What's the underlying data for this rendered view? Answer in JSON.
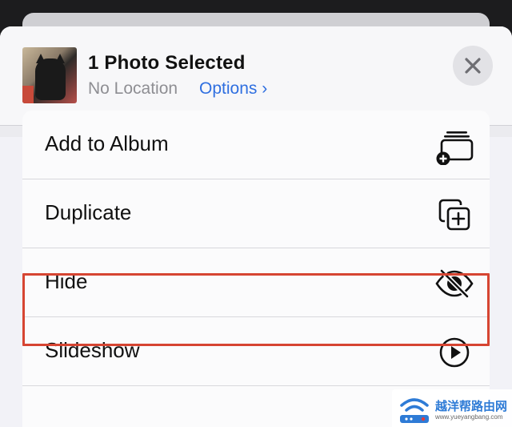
{
  "sheet": {
    "title": "1 Photo Selected",
    "location": "No Location",
    "options_label": "Options ›"
  },
  "menu": {
    "items": [
      {
        "label": "Add to Album",
        "icon": "add-to-album-icon"
      },
      {
        "label": "Duplicate",
        "icon": "duplicate-icon"
      },
      {
        "label": "Hide",
        "icon": "eye-slash-icon",
        "highlighted": true
      },
      {
        "label": "Slideshow",
        "icon": "play-circle-icon"
      }
    ]
  },
  "watermark": {
    "text": "越洋帮路由网",
    "url": "www.yueyangbang.com"
  },
  "colors": {
    "accent": "#2f6fe0",
    "highlight": "#d64532",
    "background": "#f2f2f7"
  }
}
